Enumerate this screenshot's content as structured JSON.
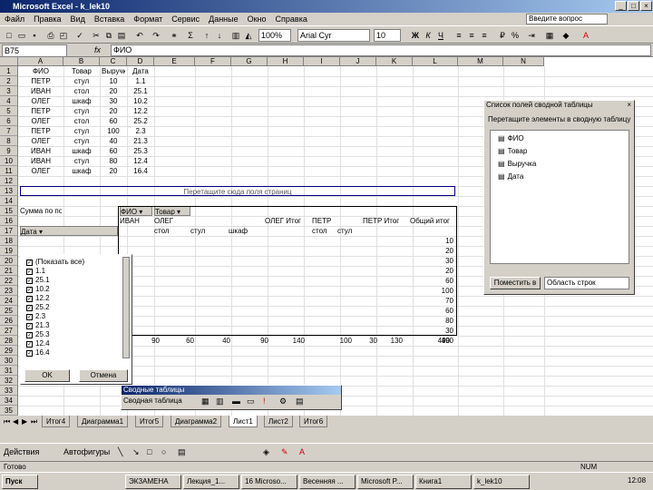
{
  "window": {
    "title": "Microsoft Excel - k_lek10"
  },
  "menu": [
    "Файл",
    "Правка",
    "Вид",
    "Вставка",
    "Формат",
    "Сервис",
    "Данные",
    "Окно",
    "Справка"
  ],
  "help_box": "Введите вопрос",
  "toolbar": {
    "font": "Arial Cyr",
    "size": "10",
    "zoom": "100%"
  },
  "formula_bar": {
    "name_box": "B75",
    "fx": "fx",
    "content": "ФИО"
  },
  "columns": [
    "A",
    "B",
    "C",
    "D",
    "E",
    "F",
    "G",
    "H",
    "I",
    "J",
    "K",
    "L",
    "M",
    "N"
  ],
  "rows": [
    "1",
    "2",
    "3",
    "4",
    "5",
    "6",
    "7",
    "8",
    "9",
    "10",
    "11",
    "12",
    "13",
    "14",
    "15",
    "16",
    "17",
    "18",
    "19",
    "20",
    "21",
    "22",
    "23",
    "24",
    "25",
    "26",
    "27",
    "28",
    "29",
    "30",
    "31",
    "32",
    "33",
    "34",
    "35"
  ],
  "source_headers": [
    "ФИО",
    "Товар",
    "Выручка",
    "Дата"
  ],
  "source_rows": [
    [
      "ПЕТР",
      "стул",
      "10",
      "1.1"
    ],
    [
      "ИВАН",
      "стол",
      "20",
      "25.1"
    ],
    [
      "ОЛЕГ",
      "шкаф",
      "30",
      "10.2"
    ],
    [
      "ПЕТР",
      "стул",
      "20",
      "12.2"
    ],
    [
      "ОЛЕГ",
      "стол",
      "60",
      "25.2"
    ],
    [
      "ПЕТР",
      "стул",
      "100",
      "2.3"
    ],
    [
      "ОЛЕГ",
      "стул",
      "40",
      "21.3"
    ],
    [
      "ИВАН",
      "шкаф",
      "60",
      "25.3"
    ],
    [
      "ИВАН",
      "стул",
      "80",
      "12.4"
    ],
    [
      "ОЛЕГ",
      "шкаф",
      "20",
      "16.4"
    ]
  ],
  "pivot": {
    "page_drop": "Перетащите сюда поля страниц",
    "data_label": "Сумма по полю Выручка",
    "field_fio": "ФИО",
    "field_tovar": "Товар",
    "row_field": "Дата",
    "col_headers": [
      "ИВАН",
      "ОЛЕГ",
      "ОЛЕГ Итог",
      "ПЕТР",
      "ПЕТР Итог",
      "Общий итог"
    ],
    "sub_headers": [
      "стол",
      "стул",
      "шкаф",
      "стол",
      "стул"
    ],
    "grand_totals": [
      "10",
      "20",
      "30",
      "20",
      "60",
      "100",
      "70",
      "60",
      "80",
      "30",
      "490"
    ],
    "bottom_values": [
      "90",
      "60",
      "40",
      "90",
      "140",
      "100",
      "30",
      "130",
      "490"
    ]
  },
  "filter": {
    "items": [
      "(Показать все)",
      "1.1",
      "25.1",
      "10.2",
      "12.2",
      "25.2",
      "2.3",
      "21.3",
      "25.3",
      "12.4",
      "16.4"
    ],
    "ok": "OK",
    "cancel": "Отмена"
  },
  "field_list": {
    "title": "Список полей сводной таблицы",
    "hint": "Перетащите элементы в сводную таблицу",
    "fields": [
      "ФИО",
      "Товар",
      "Выручка",
      "Дата"
    ],
    "move_button": "Поместить в",
    "area_select": "Область строк"
  },
  "pivot_toolbar": {
    "title": "Сводные таблицы",
    "menu": "Сводная таблица"
  },
  "sheet_tabs": [
    "Итог4",
    "Диаграмма1",
    "Итог5",
    "Диаграмма2",
    "Лист1",
    "Лист2",
    "Итог6"
  ],
  "draw_toolbar": {
    "draw": "Действия",
    "autoshapes": "Автофигуры"
  },
  "status": {
    "left": "Готово",
    "right": "NUM"
  },
  "taskbar": {
    "start": "Пуск",
    "tasks": [
      "ЭКЗАМЕНА",
      "Лекция_1...",
      "16 Microso...",
      "Весенняя ...",
      "Microsoft P...",
      "Книга1",
      "k_lek10"
    ],
    "clock": "12:08"
  }
}
